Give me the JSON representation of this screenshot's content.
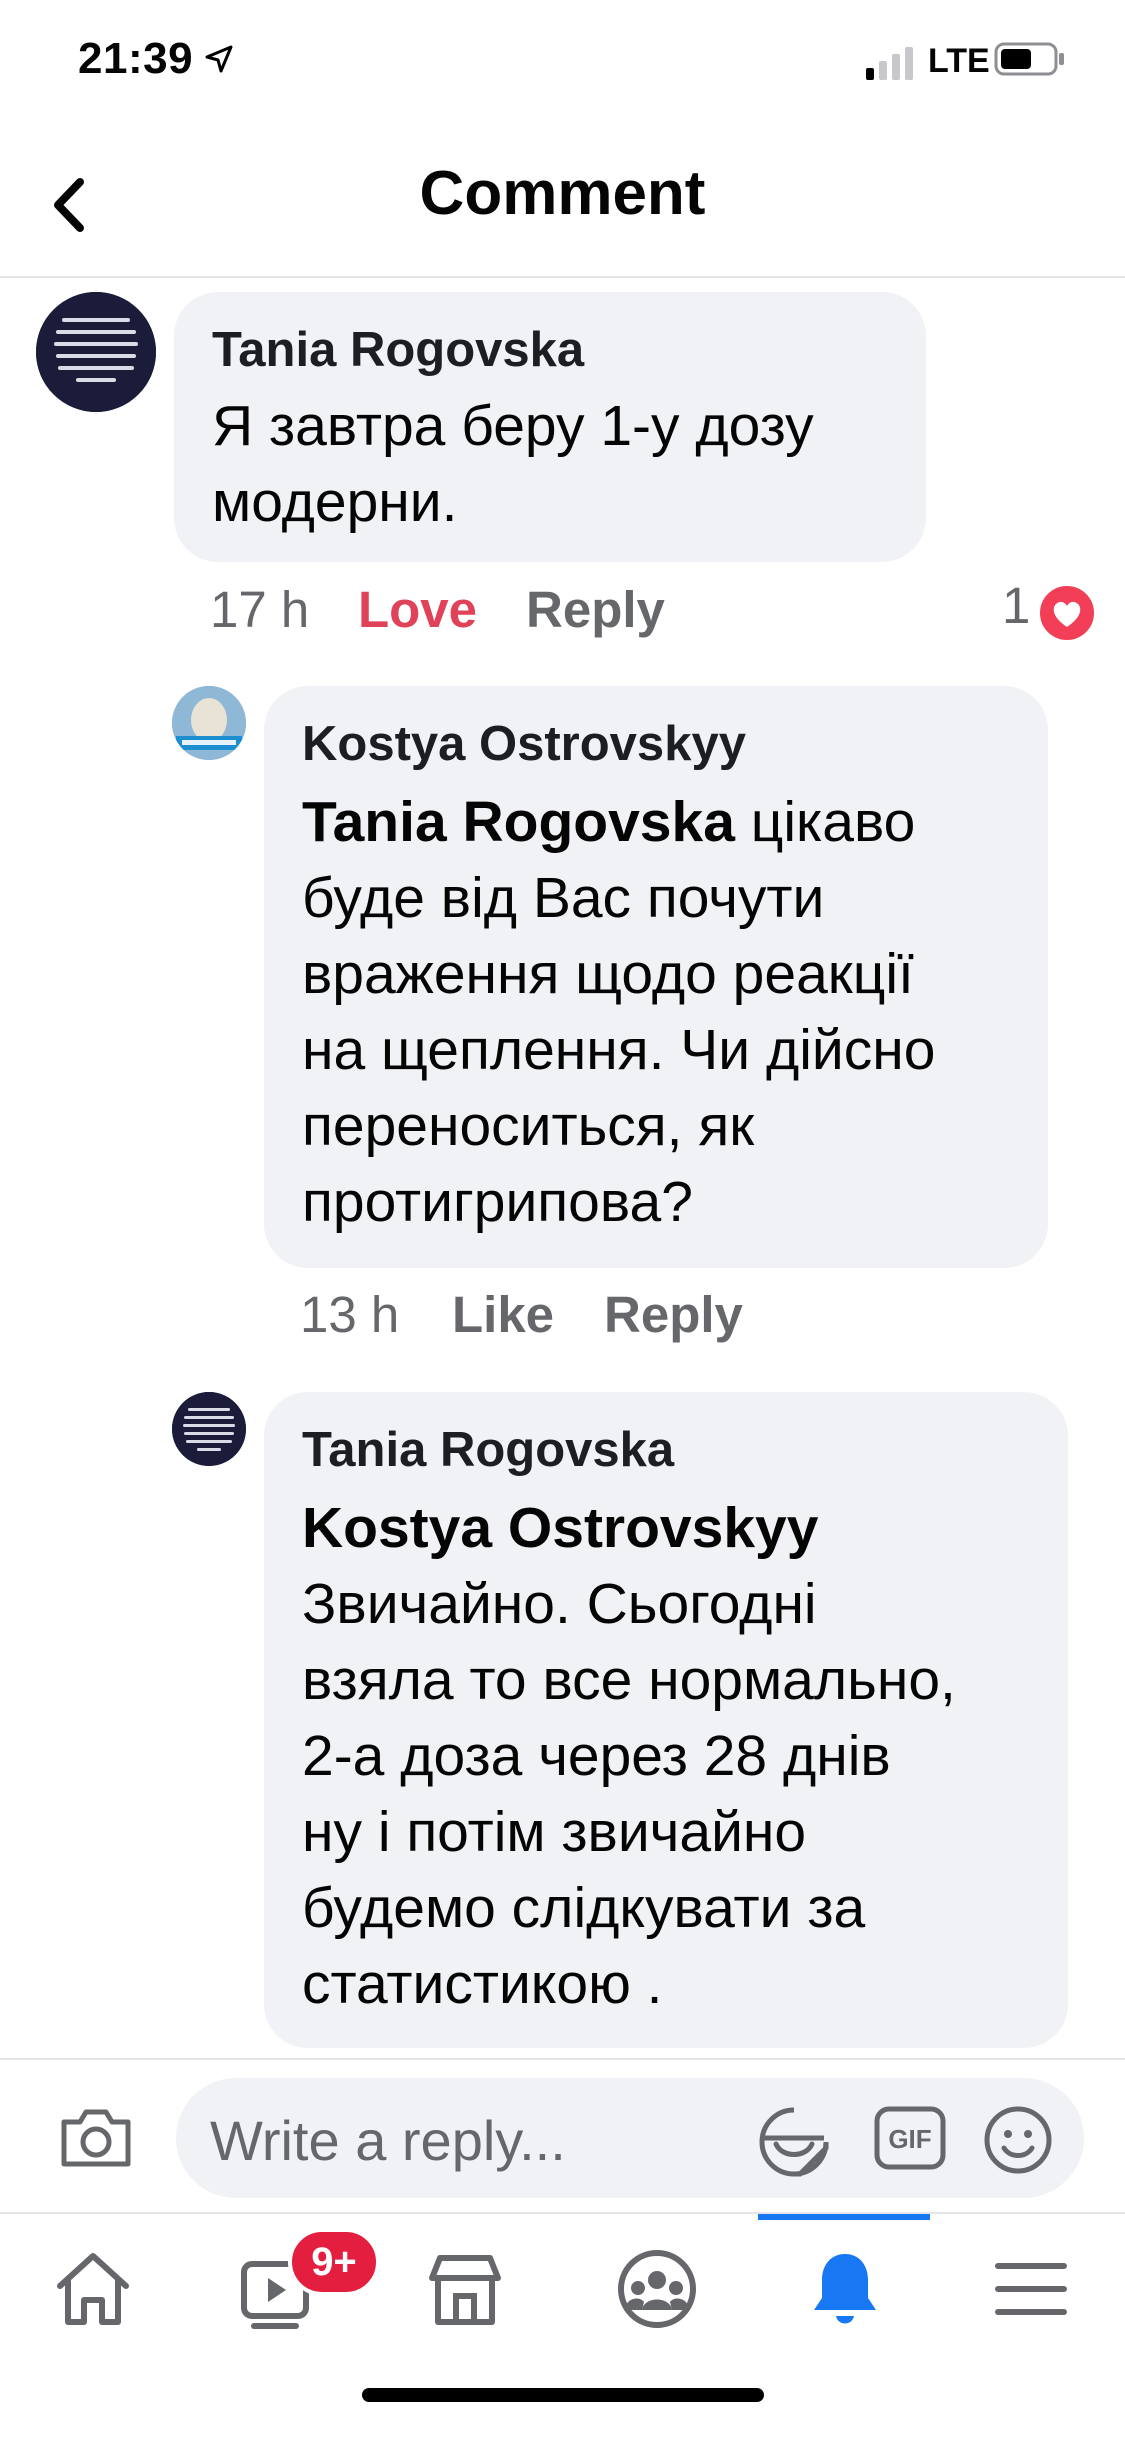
{
  "status_bar": {
    "time": "21:39",
    "network": "LTE"
  },
  "header": {
    "title": "Comment"
  },
  "comments": [
    {
      "author": "Tania Rogovska",
      "text_lines": [
        "Я завтра беру 1-у дозу",
        "модерни."
      ],
      "time": "17 h",
      "like_label": "Love",
      "reply_label": "Reply",
      "reaction_count": "1"
    },
    {
      "author": "Kostya Ostrovskyy",
      "mention": "Tania Rogovska",
      "text_lines": [
        " цікаво",
        "буде від Вас почути",
        "враження щодо реакції",
        "на щеплення. Чи дійсно",
        "переноситься, як",
        "протигрипова?"
      ],
      "time": "13 h",
      "like_label": "Like",
      "reply_label": "Reply"
    },
    {
      "author": "Tania Rogovska",
      "mention": "Kostya Ostrovskyy",
      "text_lines": [
        "Звичайно. Сьогодні",
        "взяла то все нормально,",
        "2-а доза через 28 днів",
        "ну і потім звичайно",
        "будемо слідкувати за",
        "статистикою ."
      ]
    }
  ],
  "reply_bar": {
    "placeholder": "Write a reply...",
    "gif_label": "GIF"
  },
  "tabbar": {
    "active": "notifications",
    "badge": "9+",
    "tabs": [
      "home",
      "watch",
      "marketplace",
      "groups",
      "notifications",
      "menu"
    ]
  },
  "colors": {
    "accent": "#1877f2",
    "love": "#e0425a",
    "badge": "#e41e3f",
    "bubble": "#f0f2f5"
  }
}
